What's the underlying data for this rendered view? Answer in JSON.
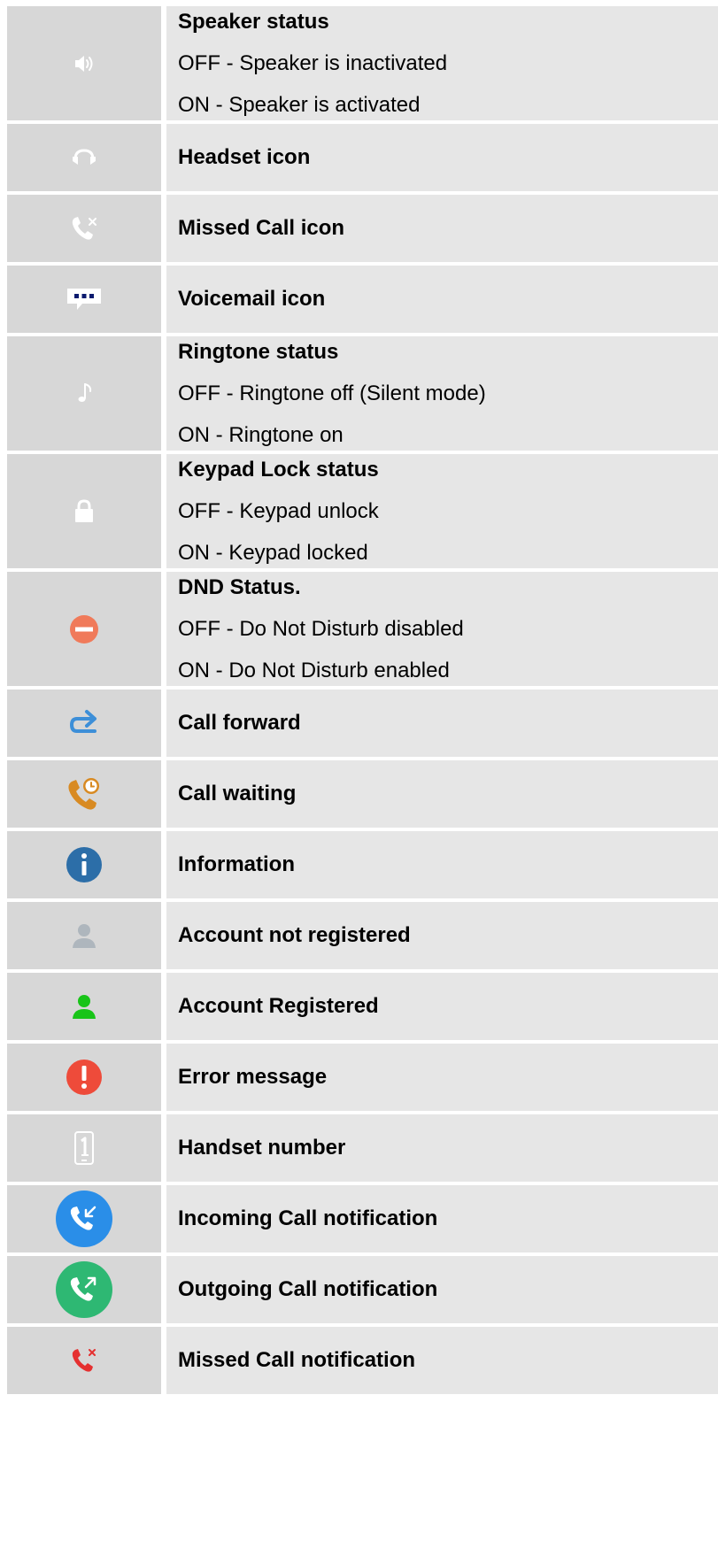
{
  "rows": [
    {
      "icon": "speaker-icon",
      "title": "Speaker status",
      "lines": [
        "OFF - Speaker is inactivated",
        "ON - Speaker is activated"
      ]
    },
    {
      "icon": "headset-icon",
      "title": "Headset icon",
      "lines": []
    },
    {
      "icon": "missed-call-icon",
      "title": "Missed Call icon",
      "lines": []
    },
    {
      "icon": "voicemail-icon",
      "title": "Voicemail icon",
      "lines": []
    },
    {
      "icon": "music-note-icon",
      "title": "Ringtone status",
      "lines": [
        "OFF - Ringtone off (Silent mode)",
        "ON - Ringtone on"
      ]
    },
    {
      "icon": "lock-icon",
      "title": "Keypad Lock status",
      "lines": [
        "OFF - Keypad unlock",
        "ON - Keypad locked"
      ]
    },
    {
      "icon": "dnd-icon",
      "title": "DND Status.",
      "lines": [
        "OFF - Do Not Disturb disabled",
        "ON - Do Not Disturb enabled"
      ]
    },
    {
      "icon": "call-forward-icon",
      "title": "Call forward",
      "lines": []
    },
    {
      "icon": "call-waiting-icon",
      "title": "Call waiting",
      "lines": []
    },
    {
      "icon": "information-icon",
      "title": "Information",
      "lines": []
    },
    {
      "icon": "account-not-registered-icon",
      "title": "Account not registered",
      "lines": []
    },
    {
      "icon": "account-registered-icon",
      "title": "Account Registered",
      "lines": []
    },
    {
      "icon": "error-icon",
      "title": "Error message",
      "lines": []
    },
    {
      "icon": "handset-number-icon",
      "title": "Handset number",
      "lines": []
    },
    {
      "icon": "incoming-call-icon",
      "title": "Incoming Call notification",
      "lines": []
    },
    {
      "icon": "outgoing-call-icon",
      "title": "Outgoing Call notification",
      "lines": []
    },
    {
      "icon": "missed-call-notification-icon",
      "title": "Missed Call notification",
      "lines": []
    }
  ],
  "colors": {
    "icon_cell_bg": "#d7d7d7",
    "desc_cell_bg": "#e6e6e6",
    "voicemail_blue": "#0a1a6e",
    "dnd_orange": "#f07a5a",
    "forward_blue": "#3d8fd8",
    "waiting_orange": "#d88a22",
    "info_blue": "#2c6ea8",
    "registered_green": "#18c418",
    "error_red": "#ee4b3a",
    "incoming_blue": "#2a8ee8",
    "outgoing_green": "#2eb873",
    "missed_red": "#e53030"
  }
}
